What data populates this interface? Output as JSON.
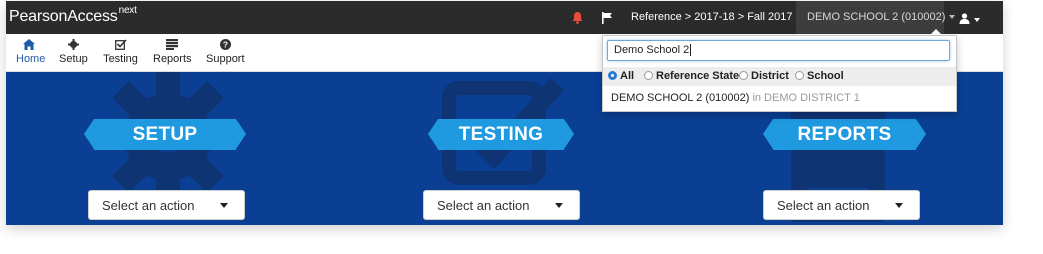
{
  "brand": {
    "name": "PearsonAccess",
    "suffix": "next"
  },
  "topbar": {
    "breadcrumb": "Reference > 2017-18 > Fall 2017",
    "organization": "DEMO SCHOOL 2 (010002)",
    "alert_color": "#e74c3c"
  },
  "nav": {
    "items": [
      {
        "label": "Home",
        "icon": "home-icon"
      },
      {
        "label": "Setup",
        "icon": "gear-icon"
      },
      {
        "label": "Testing",
        "icon": "checkbox-icon"
      },
      {
        "label": "Reports",
        "icon": "report-icon"
      },
      {
        "label": "Support",
        "icon": "help-icon"
      }
    ],
    "active": "Home"
  },
  "tiles": [
    {
      "title": "SETUP",
      "action": "Select an action",
      "icon": "gear-icon"
    },
    {
      "title": "TESTING",
      "action": "Select an action",
      "icon": "checkbox-icon"
    },
    {
      "title": "REPORTS",
      "action": "Select an action",
      "icon": "report-icon"
    }
  ],
  "org_search": {
    "query": "Demo School 2",
    "filters": [
      "All",
      "Reference State",
      "District",
      "School"
    ],
    "selected_filter": "All",
    "result": {
      "name": "DEMO SCHOOL 2 (010002)",
      "context": "in DEMO DISTRICT 1"
    }
  },
  "colors": {
    "primary": "#0a3f93",
    "banner": "#1f9ae0",
    "topbar": "#2b2b2b"
  }
}
